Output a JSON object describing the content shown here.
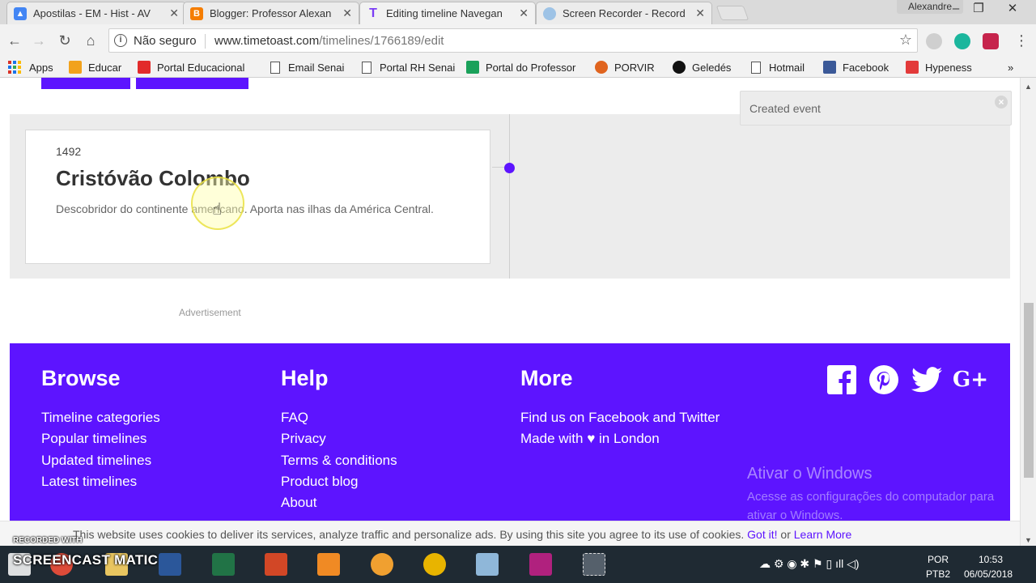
{
  "browser": {
    "tabs": [
      {
        "title": "Apostilas - EM - Hist - AV"
      },
      {
        "title": "Blogger: Professor Alexan"
      },
      {
        "title": "Editing timeline Navegan"
      },
      {
        "title": "Screen Recorder - Record"
      }
    ],
    "user_name": "Alexandre",
    "security_label": "Não seguro",
    "url_host": "www.timetoast.com",
    "url_path": "/timelines/1766189/edit",
    "bookmarks": [
      {
        "label": "Apps"
      },
      {
        "label": "Educar"
      },
      {
        "label": "Portal Educacional"
      },
      {
        "label": "Email Senai"
      },
      {
        "label": "Portal RH Senai"
      },
      {
        "label": "Portal do Professor"
      },
      {
        "label": "PORVIR"
      },
      {
        "label": "Geledés"
      },
      {
        "label": "Hotmail"
      },
      {
        "label": "Facebook"
      },
      {
        "label": "Hypeness"
      }
    ],
    "bookmarks_overflow": "»"
  },
  "event": {
    "year": "1492",
    "title": "Cristóvão Colombo",
    "description": "Descobridor do continente americano. Aporta nas ilhas da América Central."
  },
  "toast": {
    "message": "Created event",
    "close": "×"
  },
  "advertisement_label": "Advertisement",
  "footer": {
    "browse": {
      "heading": "Browse",
      "links": [
        "Timeline categories",
        "Popular timelines",
        "Updated timelines",
        "Latest timelines"
      ]
    },
    "help": {
      "heading": "Help",
      "links": [
        "FAQ",
        "Privacy",
        "Terms & conditions",
        "Product blog",
        "About"
      ]
    },
    "more": {
      "heading": "More",
      "links": [
        "Find us on Facebook and Twitter",
        "Made with ♥ in London"
      ]
    },
    "social": [
      "facebook-icon",
      "pinterest-icon",
      "twitter-icon",
      "google-plus-icon"
    ],
    "windows_watermark": {
      "title": "Ativar o Windows",
      "body": "Acesse as configurações do computador para ativar o Windows."
    }
  },
  "cookie_bar": {
    "text": "This website uses cookies to deliver its services, analyze traffic and personalize ads. By using this site you agree to its use of cookies.",
    "got_it": "Got it!",
    "or": "or",
    "learn_more": "Learn More"
  },
  "recorder": {
    "recorded_with": "RECORDED WITH",
    "brand": "SCREENCAST  MATIC"
  },
  "taskbar": {
    "language": "POR",
    "layout": "PTB2",
    "time": "10:53",
    "date": "06/05/2018"
  },
  "colors": {
    "brand_purple": "#5d14ff",
    "toast_bg": "#ececec",
    "taskbar": "#1f2a33"
  }
}
